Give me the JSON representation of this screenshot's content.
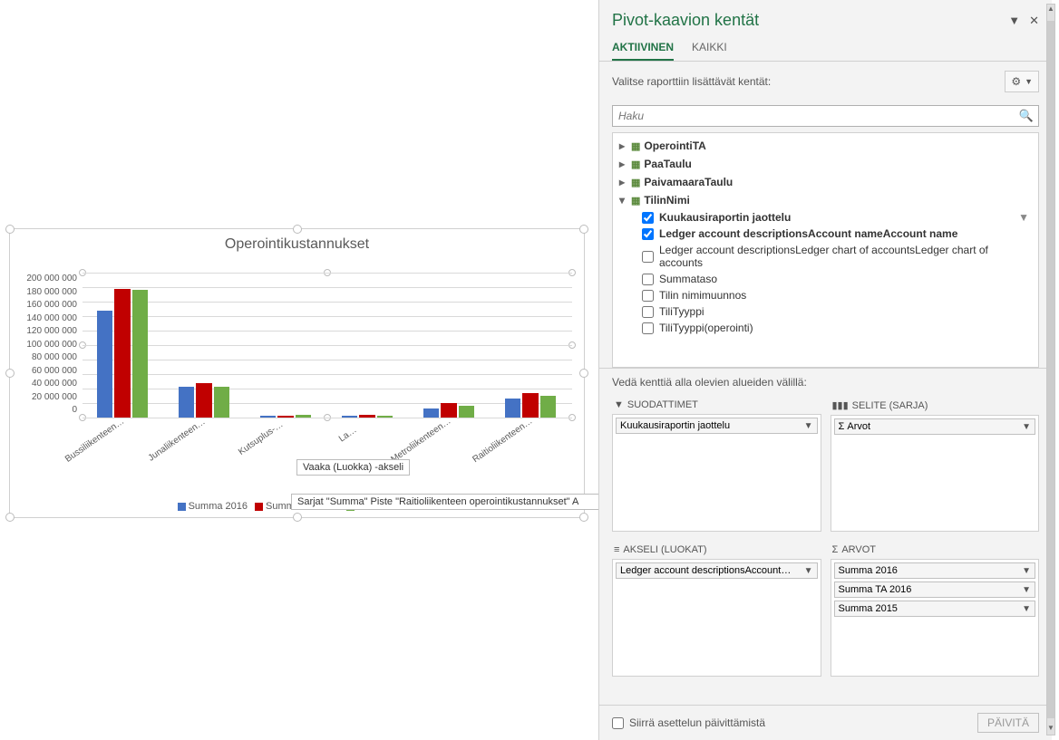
{
  "chart": {
    "title": "Operointikustannukset",
    "yticks": [
      "200 000 000",
      "180 000 000",
      "160 000 000",
      "140 000 000",
      "120 000 000",
      "100 000 000",
      "80 000 000",
      "60 000 000",
      "40 000 000",
      "20 000 000",
      "0"
    ],
    "legend": [
      "Summa 2016",
      "Summa TA 2016",
      "Summa 2015"
    ],
    "colors": [
      "#4472c4",
      "#c00000",
      "#70ad47"
    ],
    "tooltip1": "Vaaka (Luokka)  -akseli",
    "tooltip2": "Sarjat \"Summa\" Piste \"Raitioliikenteen operointikustannukset\" A"
  },
  "chart_data": {
    "type": "bar",
    "title": "Operointikustannukset",
    "ylim": [
      0,
      200000000
    ],
    "categories": [
      "Bussiliikenteen…",
      "Junaliikenteen…",
      "Kutsuplus-…",
      "La…",
      "Metroliikenteen…",
      "Raitioliikenteen…"
    ],
    "series": [
      {
        "name": "Summa 2016",
        "values": [
          148000000,
          42000000,
          2000000,
          3000000,
          12000000,
          26000000
        ]
      },
      {
        "name": "Summa TA 2016",
        "values": [
          178000000,
          48000000,
          3000000,
          4000000,
          20000000,
          34000000
        ]
      },
      {
        "name": "Summa 2015",
        "values": [
          176000000,
          42000000,
          4000000,
          2000000,
          16000000,
          30000000
        ]
      }
    ]
  },
  "pane": {
    "title": "Pivot-kaavion kentät",
    "tabs": {
      "active": "AKTIIVINEN",
      "all": "KAIKKI"
    },
    "instructions": "Valitse raporttiin lisättävät kentät:",
    "search_placeholder": "Haku",
    "tables": [
      {
        "name": "OperointiTA",
        "expanded": false
      },
      {
        "name": "PaaTaulu",
        "expanded": false
      },
      {
        "name": "PaivamaaraTaulu",
        "expanded": false
      },
      {
        "name": "TilinNimi",
        "expanded": true
      }
    ],
    "fields": [
      {
        "label": "Kuukausiraportin jaottelu",
        "checked": true,
        "hasFilter": true
      },
      {
        "label": "Ledger account descriptionsAccount nameAccount name",
        "checked": true
      },
      {
        "label": "Ledger account descriptionsLedger chart of accountsLedger chart of accounts",
        "checked": false
      },
      {
        "label": "Summataso",
        "checked": false
      },
      {
        "label": "Tilin nimimuunnos",
        "checked": false
      },
      {
        "label": "TiliTyyppi",
        "checked": false
      },
      {
        "label": "TiliTyyppi(operointi)",
        "checked": false
      }
    ],
    "drag_instr": "Vedä kenttiä alla olevien alueiden välillä:",
    "zones": {
      "filters": {
        "title": "SUODATTIMET",
        "items": [
          "Kuukausiraportin jaottelu"
        ]
      },
      "legend": {
        "title": "SELITE (SARJA)",
        "items": [
          "Σ  Arvot"
        ]
      },
      "axis": {
        "title": "AKSELI (LUOKAT)",
        "items": [
          "Ledger account descriptionsAccount…"
        ]
      },
      "values": {
        "title": "ARVOT",
        "items": [
          "Summa 2016",
          "Summa TA 2016",
          "Summa 2015"
        ]
      }
    },
    "footer": {
      "defer": "Siirrä asettelun päivittämistä",
      "update": "PÄIVITÄ"
    }
  }
}
